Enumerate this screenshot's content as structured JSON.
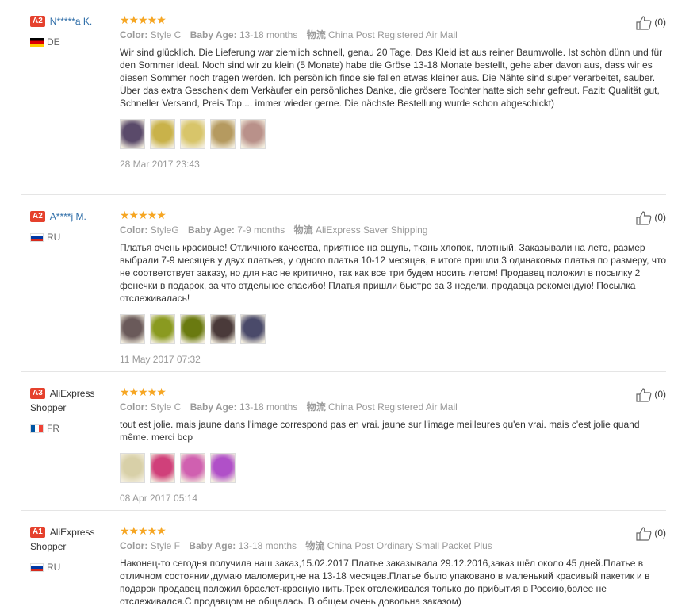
{
  "reviews": [
    {
      "level": "A2",
      "name": "N*****a K.",
      "name_style": "link",
      "country": "DE",
      "flag": "de",
      "stars": "★★★★★",
      "color_label": "Color:",
      "color": "Style C",
      "age_label": "Baby Age:",
      "age": "13-18 months",
      "ship_label": "物流",
      "shipping": "China Post Registered Air Mail",
      "text": "Wir sind glücklich. Die Lieferung war ziemlich schnell, genau 20 Tage. Das Kleid ist aus reiner Baumwolle. Ist schön dünn und für den Sommer ideal. Noch sind wir zu klein (5 Monate) habe die Gröse 13-18 Monate bestellt, gehe aber davon aus, dass wir es diesen Sommer noch tragen werden. Ich persönlich finde sie fallen etwas kleiner aus. Die Nähte sind super verarbeitet, sauber. Über das extra Geschenk dem Verkäufer ein persönliches Danke, die grösere Tochter hatte sich sehr gefreut. Fazit: Qualität gut, Schneller Versand, Preis Top.... immer wieder gerne. Die nächste Bestellung wurde schon abgeschickt)",
      "thumb_colors": [
        "#5a4a6a",
        "#c9b24a",
        "#d8c56a",
        "#b59a60",
        "#b9918a"
      ],
      "date": "28 Mar 2017 23:43",
      "likes": "(0)"
    },
    {
      "level": "A2",
      "name": "A****j M.",
      "name_style": "link",
      "country": "RU",
      "flag": "ru",
      "stars": "★★★★★",
      "color_label": "Color:",
      "color": "StyleG",
      "age_label": "Baby Age:",
      "age": "7-9 months",
      "ship_label": "物流",
      "shipping": "AliExpress Saver Shipping",
      "text": "Платья очень красивые! Отличного качества, приятное на ощупь, ткань хлопок, плотный. Заказывали на лето, размер выбрали 7-9 месяцев у двух платьев, у одного платья 10-12 месяцев, в итоге пришли 3 одинаковых платья по размеру, что не соответствует заказу, но для нас не критично, так как все три будем носить летом! Продавец положил в посылку 2 фенечки в подарок, за что отдельное спасибо! Платья пришли быстро за 3 недели, продавца рекомендую! Посылка отслеживалась!",
      "thumb_colors": [
        "#6a5a5a",
        "#8a9a20",
        "#6a7a10",
        "#4a3a3a",
        "#4a4a6a"
      ],
      "date": "11 May 2017 07:32",
      "likes": "(0)"
    },
    {
      "level": "A3",
      "name": "AliExpress Shopper",
      "name_style": "plain",
      "country": "FR",
      "flag": "fr",
      "stars": "★★★★★",
      "color_label": "Color:",
      "color": "Style C",
      "age_label": "Baby Age:",
      "age": "13-18 months",
      "ship_label": "物流",
      "shipping": "China Post Registered Air Mail",
      "text": "tout est jolie. mais jaune dans l'image correspond pas en vrai. jaune sur l'image meilleures qu'en vrai. mais c'est jolie quand même. merci bcp",
      "thumb_colors": [
        "#d8d0a8",
        "#d0407a",
        "#d060b0",
        "#b050c8"
      ],
      "date": "08 Apr 2017 05:14",
      "likes": "(0)"
    },
    {
      "level": "A1",
      "name": "AliExpress Shopper",
      "name_style": "plain",
      "country": "RU",
      "flag": "ru",
      "stars": "★★★★★",
      "color_label": "Color:",
      "color": "Style F",
      "age_label": "Baby Age:",
      "age": "13-18 months",
      "ship_label": "物流",
      "shipping": "China Post Ordinary Small Packet Plus",
      "text": "Наконец-то сегодня получила наш заказ,15.02.2017.Платье заказывала 29.12.2016,заказ шёл около 45 дней.Платье в отличном состоянии,думаю маломерит,не на 13-18 месяцев.Платье было упаковано в маленький красивый пакетик и в подарок продавец положил браслет-красную нить.Трек отслеживался только до прибытия в Россию,более не отслеживался.С продавцом не общалась. В общем очень довольна заказом)",
      "thumb_colors": [],
      "date": "",
      "likes": "(0)"
    }
  ]
}
